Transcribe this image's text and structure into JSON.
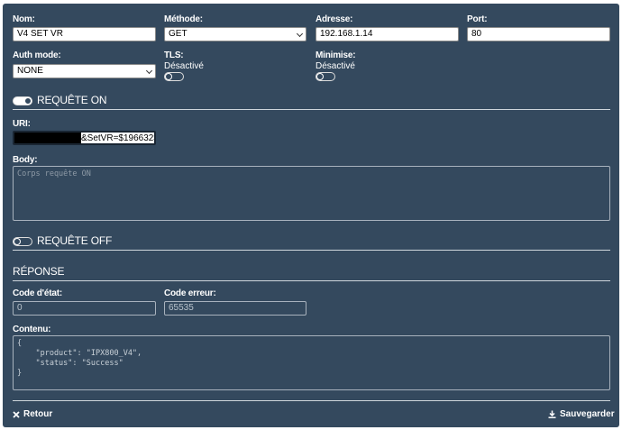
{
  "fields": {
    "nom": {
      "label": "Nom:",
      "value": "V4 SET VR"
    },
    "methode": {
      "label": "Méthode:",
      "value": "GET"
    },
    "adresse": {
      "label": "Adresse:",
      "value": "192.168.1.14"
    },
    "port": {
      "label": "Port:",
      "value": "80"
    },
    "auth": {
      "label": "Auth mode:",
      "value": "NONE"
    },
    "tls": {
      "label": "TLS:",
      "state": "Désactivé"
    },
    "minimise": {
      "label": "Minimise:",
      "state": "Désactivé"
    }
  },
  "request_on": {
    "title": "REQUÊTE ON",
    "uri_label": "URI:",
    "uri_value": "&SetVR=$196632$",
    "body_label": "Body:",
    "body_placeholder": "Corps requête ON"
  },
  "request_off": {
    "title": "REQUÊTE OFF"
  },
  "response": {
    "title": "RÉPONSE",
    "code_etat_label": "Code d'état:",
    "code_etat_value": "0",
    "code_erreur_label": "Code erreur:",
    "code_erreur_value": "65535",
    "contenu_label": "Contenu:",
    "contenu_value": "{\n    \"product\": \"IPX800_V4\",\n    \"status\": \"Success\"\n}"
  },
  "actions": {
    "retour": "Retour",
    "sauvegarder": "Sauvegarder"
  },
  "colors": {
    "panel": "#34495e",
    "text": "#ffffff"
  }
}
